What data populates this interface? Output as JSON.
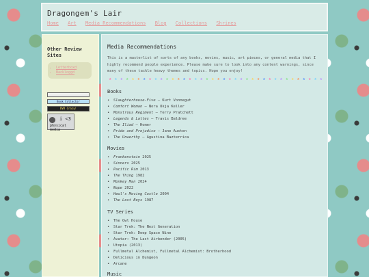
{
  "site": {
    "title": "Dragongem's Lair",
    "nav": [
      "Home",
      "Art",
      "Media Recommendations",
      "Blog",
      "Collections",
      "Shrines"
    ]
  },
  "sidebar": {
    "heading": "Other Review Sites",
    "links": [
      "Letterboxd",
      "Backloggd"
    ],
    "badges": {
      "badge1": "",
      "badge2": "Book Collector",
      "badge3": "DVD Crazy!",
      "badge4_heart": "i <3",
      "badge4_sub": "physical media"
    }
  },
  "main": {
    "title": "Media Recommendations",
    "intro": "This is a masterlist of sorts of any books, movies, music, art pieces, or general media that I highly recommend people experience. Please make sure to look into any content warnings, since many of these tackle heavy themes and topics. Hope you enjoy!",
    "star_colors": [
      "#ff6fb0",
      "#6fd0ff",
      "#b887ff",
      "#7fe07f",
      "#ffd24d",
      "#ff8a4d",
      "#4d8aff"
    ],
    "sections": {
      "books": {
        "heading": "Books",
        "items": [
          {
            "title": "Slaughterhouse-Five",
            "suffix": " – Kurt Vonnegut"
          },
          {
            "title": "Comfort Woman",
            "suffix": " – Nora Okja Keller"
          },
          {
            "title": "Monstrous Regiment",
            "suffix": " – Terry Pratchett"
          },
          {
            "title": "Legends & Lattes",
            "suffix": " – Travis Baldree"
          },
          {
            "title": "The Iliad",
            "suffix": " – Homer"
          },
          {
            "title": "Pride and Prejudice",
            "suffix": " – Jane Austen"
          },
          {
            "title": "The Unworthy",
            "suffix": " – Agustina Bazterrica"
          }
        ]
      },
      "movies": {
        "heading": "Movies",
        "items": [
          {
            "title": "Frankenstein",
            "suffix": " 2025"
          },
          {
            "title": "Sinners",
            "suffix": " 2025"
          },
          {
            "title": "Pacific Rim",
            "suffix": " 2013"
          },
          {
            "title": "The Thing",
            "suffix": " 1982"
          },
          {
            "title": "Monkey Man",
            "suffix": " 2024"
          },
          {
            "title": "Nope",
            "suffix": " 2022"
          },
          {
            "title": "Howl's Moving Castle",
            "suffix": " 2004"
          },
          {
            "title": "The Lost Boys",
            "suffix": " 1987"
          }
        ]
      },
      "tv": {
        "heading": "TV Series",
        "items": [
          "The Owl House",
          "Star Trek: The Next Generation",
          "Star Trek: Deep Space Nine",
          "Avatar: The Last Airbender (2005)",
          "Utopia (2013)",
          "Fullmetal Alchemist, Fullmetal Alchemist: Brotherhood",
          "Delicious in Dungeon",
          "Arcane"
        ]
      },
      "music": {
        "heading": "Music"
      }
    }
  }
}
